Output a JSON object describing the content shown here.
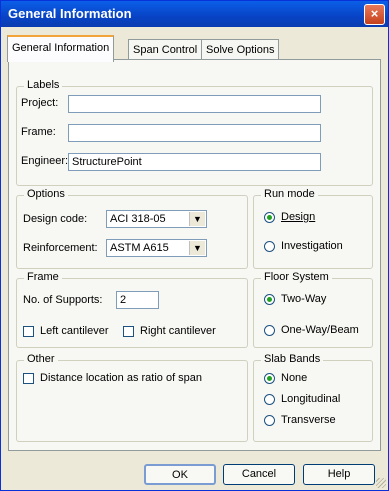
{
  "window": {
    "title": "General Information",
    "close_glyph": "×"
  },
  "tabs": [
    "General Information",
    "Span Control",
    "Solve Options"
  ],
  "labels": {
    "legend": "Labels",
    "project_label": "Project:",
    "project_value": "",
    "frame_label": "Frame:",
    "frame_value": "",
    "engineer_label": "Engineer:",
    "engineer_value": "StructurePoint"
  },
  "options": {
    "legend": "Options",
    "design_code_label": "Design code:",
    "design_code_value": "ACI 318-05",
    "reinforcement_label": "Reinforcement:",
    "reinforcement_value": "ASTM A615",
    "arrow_glyph": "▼"
  },
  "run_mode": {
    "legend": "Run mode",
    "design": "Design",
    "investigation": "Investigation",
    "selected": "design"
  },
  "frame": {
    "legend": "Frame",
    "supports_label": "No. of Supports:",
    "supports_value": "2",
    "left_cantilever": "Left cantilever",
    "right_cantilever": "Right cantilever"
  },
  "floor_system": {
    "legend": "Floor System",
    "two_way": "Two-Way",
    "one_way": "One-Way/Beam",
    "selected": "two-way"
  },
  "other": {
    "legend": "Other",
    "distance_ratio": "Distance location as ratio of span"
  },
  "slab_bands": {
    "legend": "Slab Bands",
    "none": "None",
    "longitudinal": "Longitudinal",
    "transverse": "Transverse",
    "selected": "none"
  },
  "buttons": {
    "ok": "OK",
    "cancel": "Cancel",
    "help": "Help"
  }
}
